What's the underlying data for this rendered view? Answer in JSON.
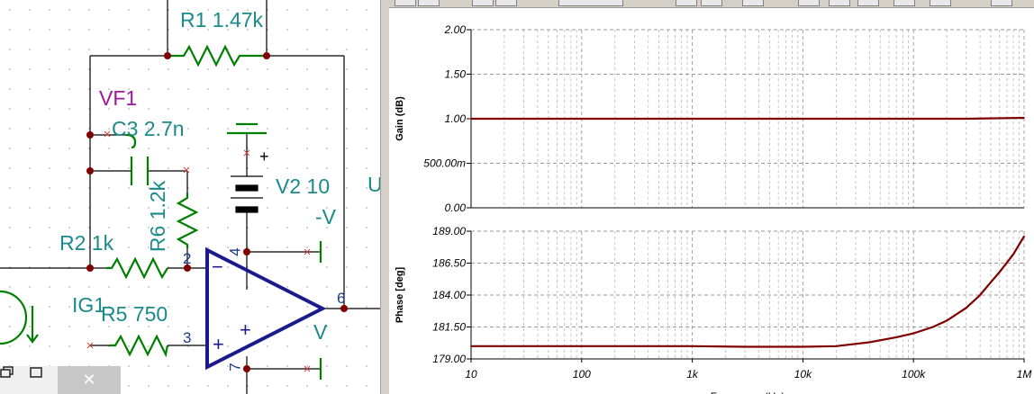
{
  "schematic": {
    "components": {
      "r1": "R1 1.47k",
      "vf1": "VF1",
      "c3": "C3 2.7n",
      "r6": "R6 1.2k",
      "v2_line1": "V2 10",
      "v2_line2": "-V",
      "r2": "R2 1k",
      "ig1": "IG1",
      "r5": "R5 750",
      "out_v": "V",
      "edge_u": "U"
    },
    "pins": {
      "p2": "2",
      "p3": "3",
      "p4": "4",
      "p6": "6",
      "p7": "7"
    },
    "opamp_signs": {
      "minus": "−",
      "plus_in": "+",
      "plus_body": "+"
    },
    "battery_plus": "+",
    "colors": {
      "wire": "#000000",
      "component": "#008000",
      "label": "#1a8a8a",
      "opamp": "#1a1a8c",
      "junction": "#800000",
      "vf": "#9b1a9b",
      "pin": "#1a3a8c"
    }
  },
  "window_controls": {
    "restore_icon": "restore-icon",
    "maximize_icon": "maximize-icon",
    "close_icon": "close-icon",
    "close_glyph": "✕"
  },
  "chart_data": [
    {
      "type": "line",
      "ylabel": "Gain (dB)",
      "xscale": "log",
      "xlim": [
        10,
        1000000
      ],
      "ylim": [
        0,
        2
      ],
      "yticks": [
        "2.00",
        "1.50",
        "1.00",
        "500.00m",
        "0.00"
      ],
      "grid": true,
      "series": [
        {
          "x": [
            10,
            100,
            1000,
            10000,
            100000,
            300000,
            1000000
          ],
          "y": [
            1.0,
            1.0,
            1.0,
            1.0,
            1.0,
            1.0,
            1.01
          ]
        }
      ],
      "line_color": "#800000"
    },
    {
      "type": "line",
      "ylabel": "Phase [deg]",
      "xlabel": "Frequency (Hz)",
      "xscale": "log",
      "xlim": [
        10,
        1000000
      ],
      "ylim": [
        179,
        189
      ],
      "yticks": [
        "189.00",
        "186.50",
        "184.00",
        "181.50",
        "179.00"
      ],
      "xticks": [
        "10",
        "100",
        "1k",
        "10k",
        "100k",
        "1M"
      ],
      "grid": true,
      "series": [
        {
          "x": [
            10,
            100,
            1000,
            3000,
            10000,
            20000,
            40000,
            70000,
            100000,
            150000,
            200000,
            300000,
            400000,
            500000,
            600000,
            800000,
            1000000
          ],
          "y": [
            180.0,
            180.0,
            180.0,
            179.95,
            179.95,
            180.0,
            180.3,
            180.7,
            181.0,
            181.5,
            182.0,
            183.0,
            184.0,
            185.0,
            185.8,
            187.2,
            188.6
          ]
        }
      ],
      "line_color": "#800000"
    }
  ]
}
